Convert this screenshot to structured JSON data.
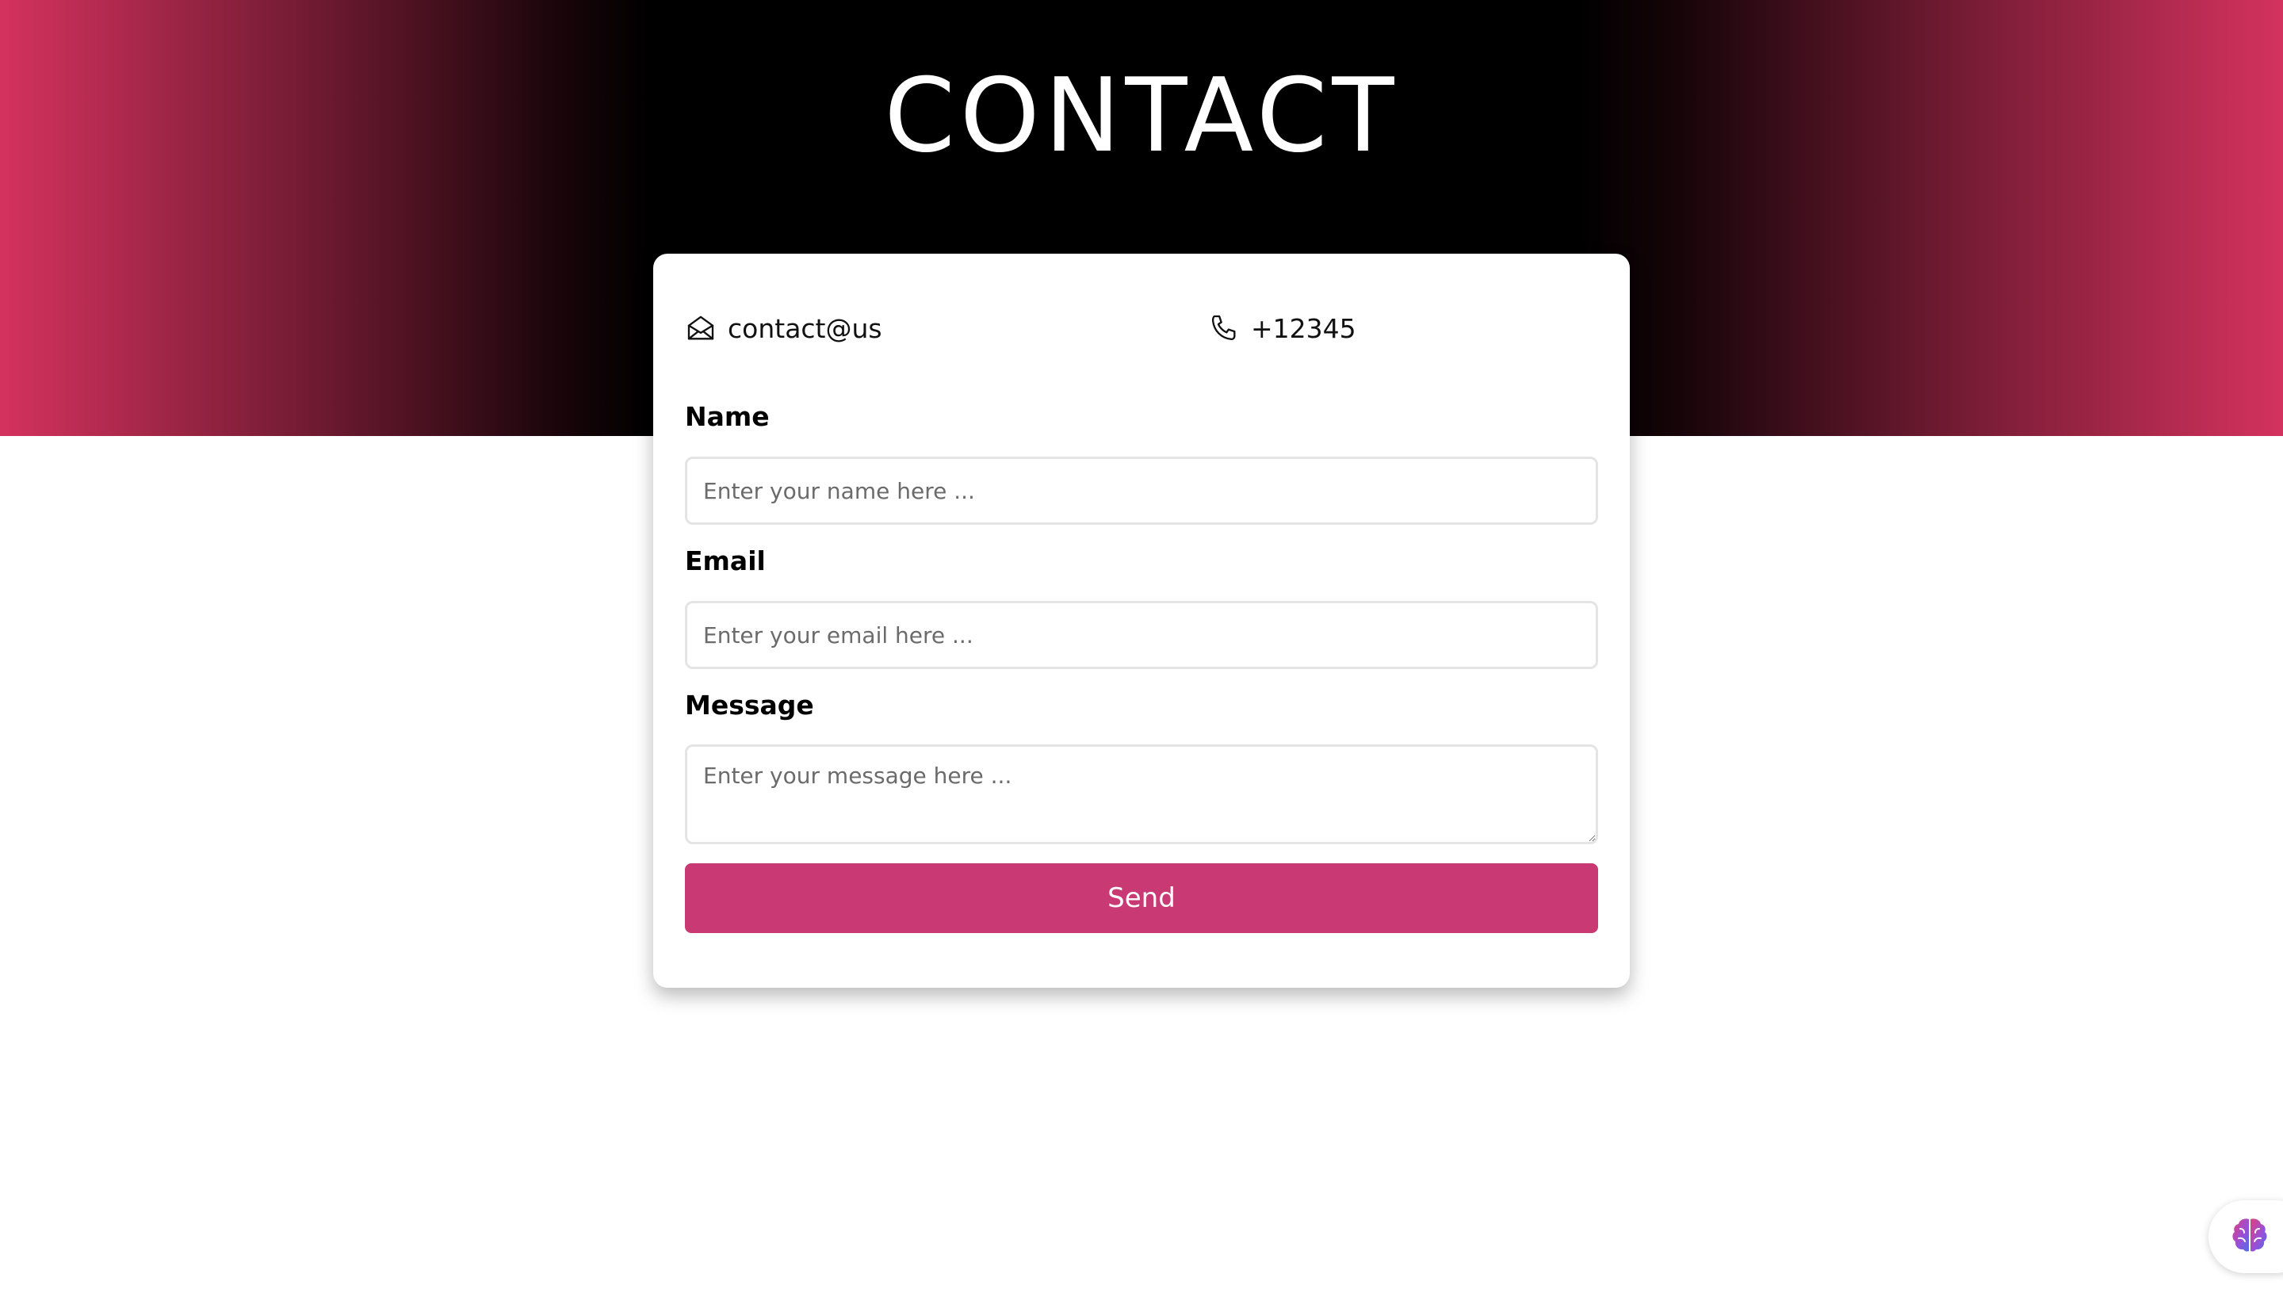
{
  "hero": {
    "title": "CONTACT",
    "gradient_edge_color": "#d4325e",
    "gradient_center_color": "#000000"
  },
  "contact": {
    "email": "contact@us",
    "email_icon": "envelope-open-icon",
    "phone": "+12345",
    "phone_icon": "phone-icon"
  },
  "form": {
    "name_label": "Name",
    "name_placeholder": "Enter your name here ...",
    "email_label": "Email",
    "email_placeholder": "Enter your email here ...",
    "message_label": "Message",
    "message_placeholder": "Enter your message here ...",
    "send_label": "Send",
    "send_color": "#c93a74"
  },
  "widget": {
    "icon": "brain-icon"
  }
}
